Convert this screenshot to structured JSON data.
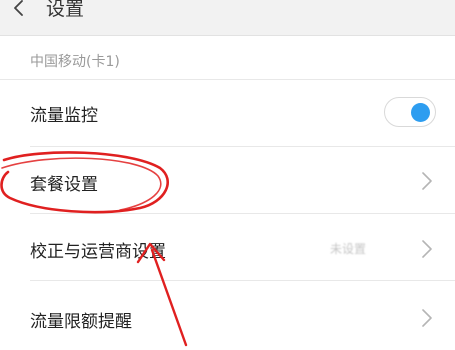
{
  "header": {
    "title": "设置",
    "back_icon": "chevron-left-icon"
  },
  "section": {
    "label": "中国移动(卡1)"
  },
  "rows": [
    {
      "label": "流量监控",
      "control": "toggle",
      "toggle_on": true
    },
    {
      "label": "套餐设置",
      "control": "chevron-right-icon"
    },
    {
      "label": "校正与运营商设置",
      "value": "未设置",
      "control": "chevron-right-icon"
    },
    {
      "label": "流量限额提醒",
      "control": "chevron-right-icon"
    }
  ],
  "colors": {
    "toggle_accent": "#2d9df0",
    "annotation": "#e02020",
    "header_bg": "#f2f2f2"
  }
}
